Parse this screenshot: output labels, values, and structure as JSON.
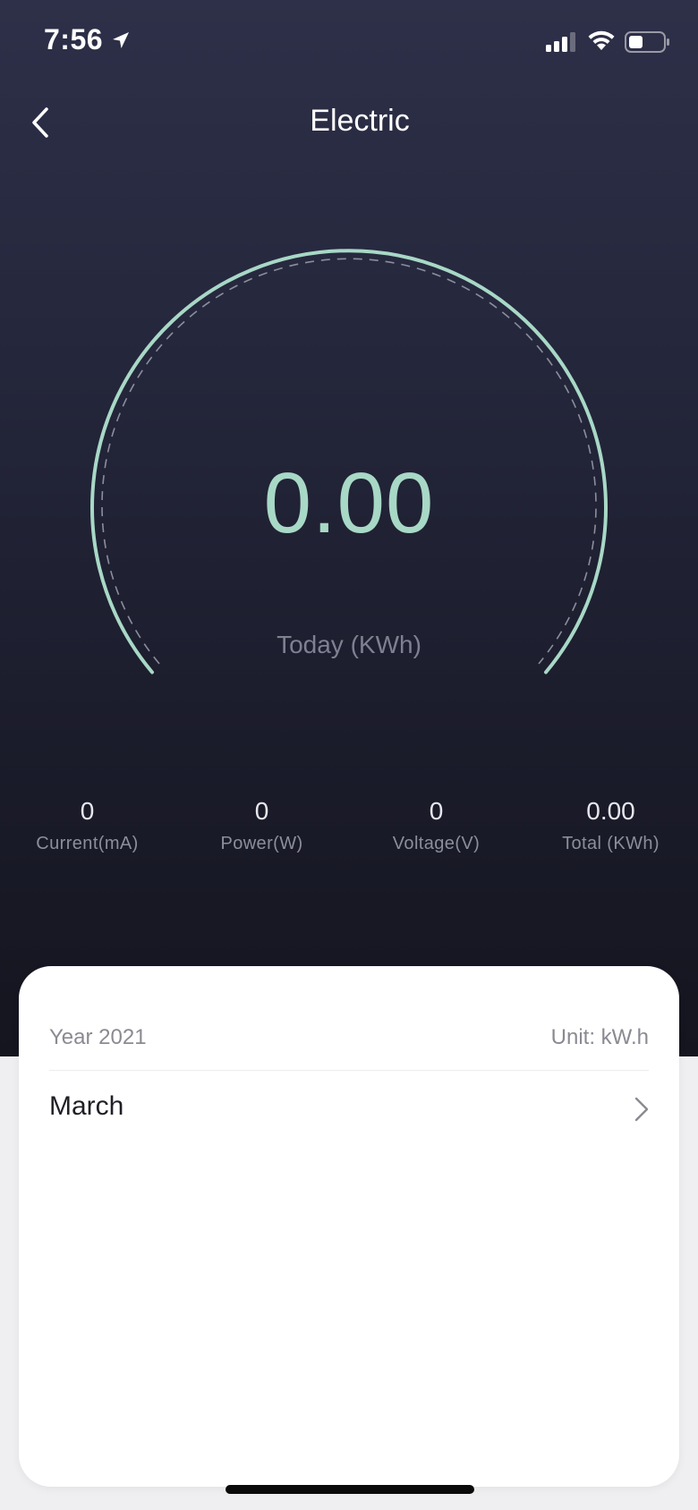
{
  "status_bar": {
    "time": "7:56",
    "icons": [
      "location-arrow-icon",
      "signal-icon",
      "wifi-icon",
      "battery-icon"
    ]
  },
  "nav": {
    "title": "Electric",
    "back_icon": "chevron-left-icon"
  },
  "gauge": {
    "value": "0.00",
    "label": "Today (KWh)",
    "arc_color": "#a8d8c6"
  },
  "stats": [
    {
      "value": "0",
      "label": "Current(mA)"
    },
    {
      "value": "0",
      "label": "Power(W)"
    },
    {
      "value": "0",
      "label": "Voltage(V)"
    },
    {
      "value": "0.00",
      "label": "Total (KWh)"
    }
  ],
  "card": {
    "year": "Year 2021",
    "unit": "Unit: kW.h",
    "months": [
      {
        "label": "March"
      }
    ]
  },
  "colors": {
    "accent": "#a8d8c6",
    "background_top": "#2e3049",
    "background_bottom": "#15151f"
  }
}
